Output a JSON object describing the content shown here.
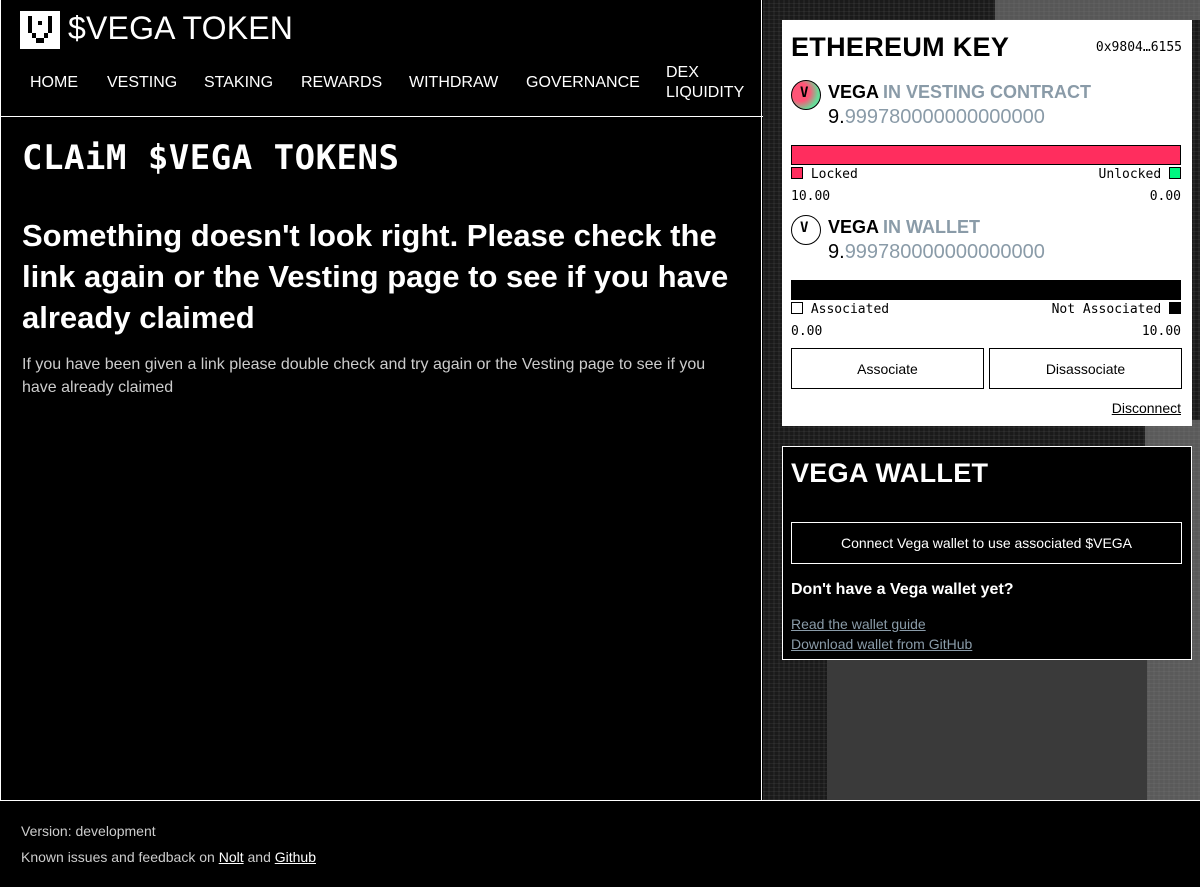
{
  "header": {
    "title": "$VEGA TOKEN",
    "nav": [
      "HOME",
      "VESTING",
      "STAKING",
      "REWARDS",
      "WITHDRAW",
      "GOVERNANCE",
      "DEX LIQUIDITY"
    ]
  },
  "main": {
    "heading": "CLAiM $VEGA TOKENS",
    "error_heading": "Something doesn't look right. Please check the link again or the Vesting page to see if you have already claimed",
    "error_detail": "If you have been given a link please double check and try again or the Vesting page to see if you have already claimed"
  },
  "eth_card": {
    "title": "ETHEREUM KEY",
    "address": "0x9804…6155",
    "vesting": {
      "token": "VEGA",
      "label": "IN VESTING CONTRACT",
      "amount_int": "9.",
      "amount_frac": "999780000000000000",
      "locked_label": "Locked",
      "unlocked_label": "Unlocked",
      "locked_value": "10.00",
      "unlocked_value": "0.00",
      "locked_color": "#ff2d5e",
      "unlocked_color": "#00f780"
    },
    "wallet": {
      "token": "VEGA",
      "label": "IN WALLET",
      "amount_int": "9.",
      "amount_frac": "999780000000000000",
      "associated_label": "Associated",
      "not_associated_label": "Not Associated",
      "associated_value": "0.00",
      "not_associated_value": "10.00"
    },
    "associate_label": "Associate",
    "disassociate_label": "Disassociate",
    "disconnect_label": "Disconnect"
  },
  "vega_card": {
    "title": "VEGA WALLET",
    "connect_label": "Connect Vega wallet to use associated $VEGA",
    "no_wallet": "Don't have a Vega wallet yet?",
    "guide_link": "Read the wallet guide",
    "download_link": "Download wallet from GitHub"
  },
  "footer": {
    "version": "Version: development",
    "feedback_prefix": "Known issues and feedback on",
    "nolt": "Nolt",
    "and": "and",
    "github": "Github"
  }
}
